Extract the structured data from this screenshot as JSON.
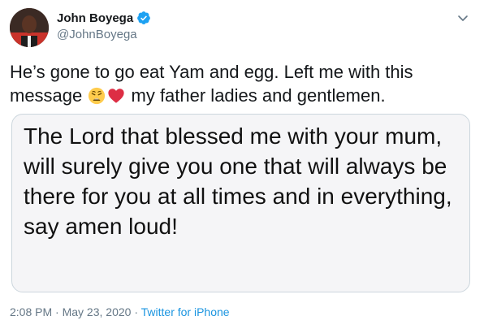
{
  "author": {
    "name": "John Boyega",
    "handle": "@JohnBoyega",
    "verified": true
  },
  "tweet": {
    "text_before": "He’s gone to go eat Yam and egg. Left me with this message ",
    "emojis": [
      "weary-face",
      "red-heart"
    ],
    "text_after": " my father ladies and gentlemen."
  },
  "image": {
    "message_text": "The Lord that blessed me with your mum, will surely give you one that will always be there for you at all times and in everything, say amen loud!"
  },
  "meta": {
    "time": "2:08 PM",
    "sep1": " · ",
    "date": "May 23, 2020",
    "sep2": " · ",
    "source": "Twitter for iPhone"
  },
  "colors": {
    "verified_blue": "#1da1f2",
    "link_blue": "#1b95e0",
    "secondary_text": "#657786"
  }
}
